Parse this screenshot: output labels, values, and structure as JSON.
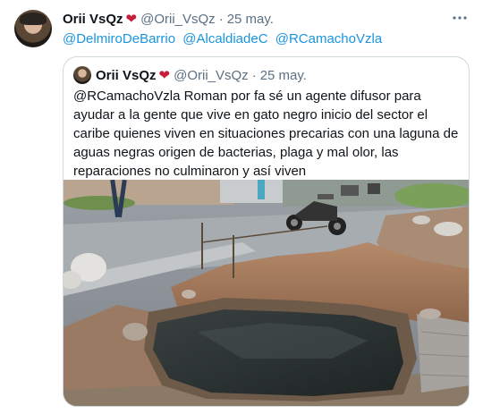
{
  "tweet": {
    "author_name": "Orii VsQz",
    "handle": "@Orii_VsQz",
    "separator": "·",
    "date": "25 may.",
    "more_icon": "more-horizontal-icon",
    "mentions": [
      "@DelmiroDeBarrio",
      "@AlcaldiadeC",
      "@RCamachoVzla"
    ]
  },
  "quote": {
    "author_name": "Orii VsQz",
    "handle": "@Orii_VsQz",
    "separator": "·",
    "date": "25 may.",
    "text": "@RCamachoVzla Roman por fa sé un agente difusor para ayudar a la gente que vive en gato negro inicio del sector el caribe quienes viven en situaciones precarias con una laguna de aguas negras origen de bacterias, plaga y mal olor, las reparaciones no culminaron y así viven"
  },
  "colors": {
    "link": "#1b95e0",
    "secondary_text": "#5b7083",
    "heart": "#c81e3c",
    "border": "#cfd9de"
  }
}
